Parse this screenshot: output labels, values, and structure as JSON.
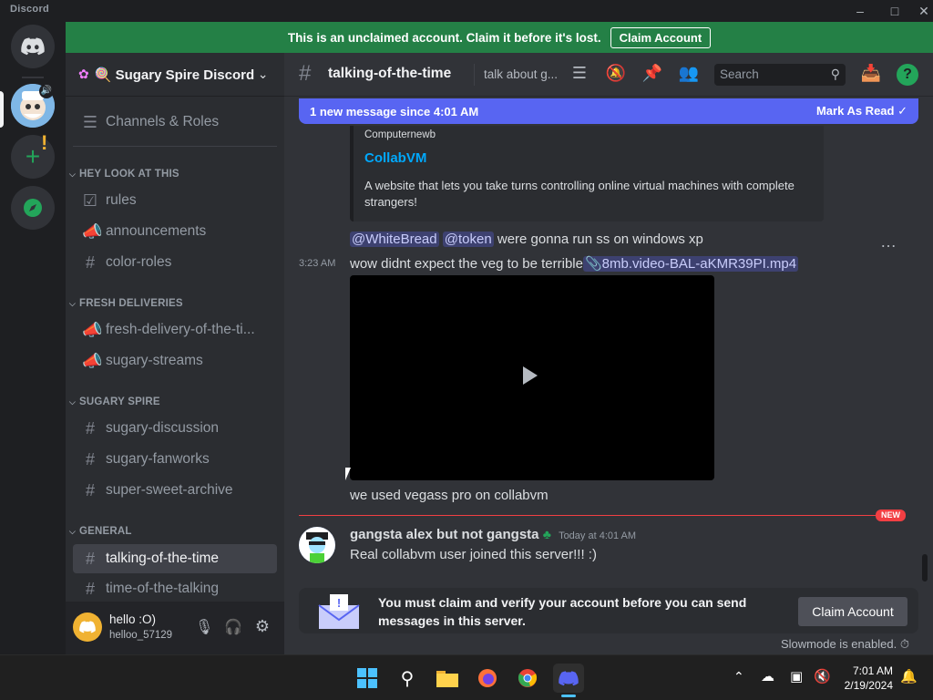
{
  "window": {
    "app_title": "Discord"
  },
  "banner": {
    "text": "This is an unclaimed account. Claim it before it's lost.",
    "button": "Claim Account"
  },
  "server": {
    "name": "🍭 Sugary Spire Discord"
  },
  "sidebar": {
    "items_top": [
      {
        "label": "Channels & Roles",
        "icon": "channels-roles-icon"
      }
    ],
    "categories": [
      {
        "name": "HEY LOOK AT THIS",
        "channels": [
          {
            "label": "rules",
            "icon": "rules-icon"
          },
          {
            "label": "announcements",
            "icon": "megaphone-icon"
          },
          {
            "label": "color-roles",
            "icon": "hash-icon"
          }
        ]
      },
      {
        "name": "FRESH DELIVERIES",
        "channels": [
          {
            "label": "fresh-delivery-of-the-ti...",
            "icon": "megaphone-icon"
          },
          {
            "label": "sugary-streams",
            "icon": "megaphone-icon"
          }
        ]
      },
      {
        "name": "SUGARY SPIRE",
        "channels": [
          {
            "label": "sugary-discussion",
            "icon": "hash-icon"
          },
          {
            "label": "sugary-fanworks",
            "icon": "hash-icon"
          },
          {
            "label": "super-sweet-archive",
            "icon": "hash-icon"
          }
        ]
      },
      {
        "name": "GENERAL",
        "channels": [
          {
            "label": "talking-of-the-time",
            "icon": "hash-icon",
            "active": true
          },
          {
            "label": "time-of-the-talking",
            "icon": "hash-icon"
          }
        ]
      }
    ]
  },
  "user": {
    "display_name": "hello :O)",
    "username": "helloo_57129"
  },
  "channel_header": {
    "name": "talking-of-the-time",
    "topic": "talk about g...",
    "search_placeholder": "Search"
  },
  "new_messages": {
    "text": "1 new message since 4:01 AM",
    "action": "Mark As Read"
  },
  "embed": {
    "provider": "Computernewb",
    "title": "CollabVM",
    "description": "A website that lets you take turns controlling online virtual machines with complete strangers!"
  },
  "messages": [
    {
      "mentions": [
        "@WhiteBread",
        "@token"
      ],
      "text": "were gonna run ss on windows xp"
    },
    {
      "time": "3:23 AM",
      "text": "wow didnt expect the veg to be terrible",
      "attachment": "8mb.video-BAL-aKMR39PI.mp4"
    },
    {
      "text": "we used vegass pro on collabvm"
    }
  ],
  "new_divider": {
    "tag": "NEW"
  },
  "latest_message": {
    "author": "gangsta alex but not gangsta",
    "timestamp": "Today at 4:01 AM",
    "text": "Real collabvm user joined this server!!! :)"
  },
  "claim_notice": {
    "text_line1": "You must claim and verify your account before you can send",
    "text_line2": "messages in this server.",
    "button": "Claim Account"
  },
  "slowmode": {
    "text": "Slowmode is enabled."
  },
  "taskbar": {
    "time": "7:01 AM",
    "date": "2/19/2024"
  }
}
